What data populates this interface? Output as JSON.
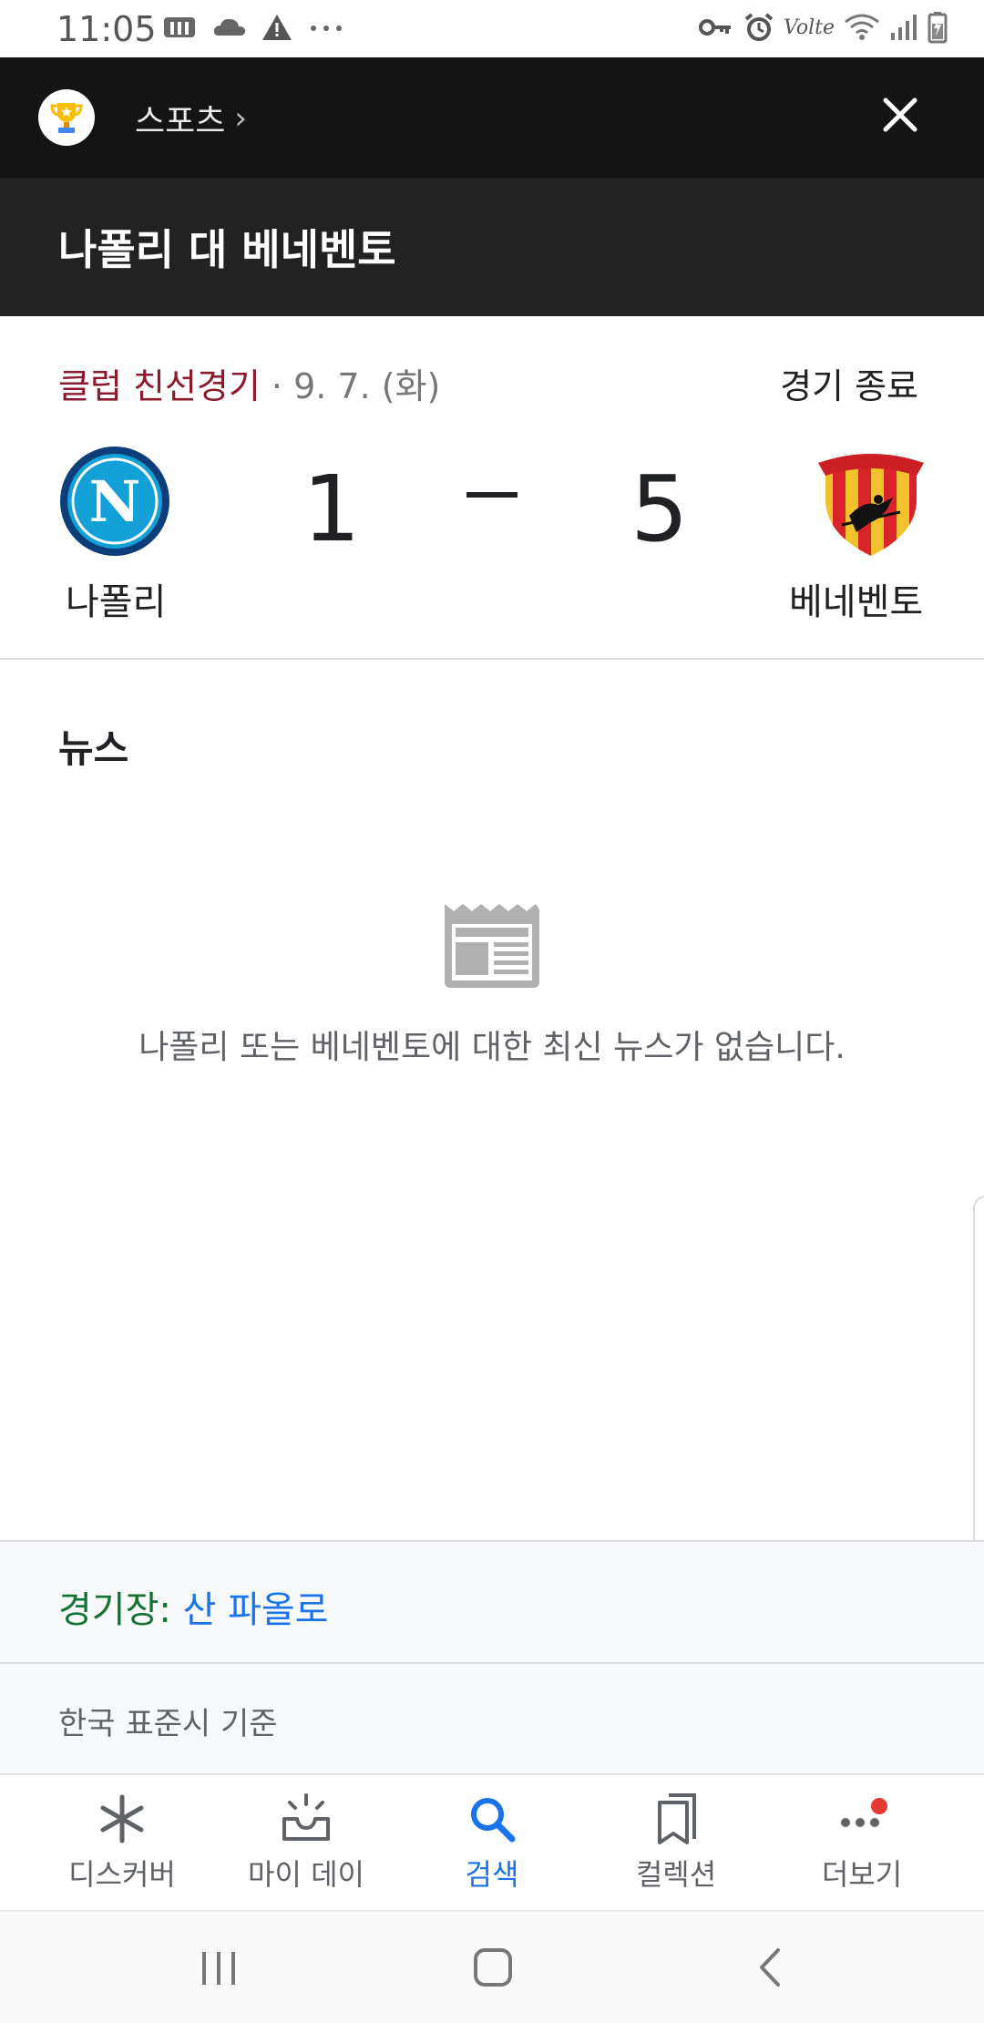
{
  "status_bar": {
    "time": "11:05",
    "left_icons": [
      "m-icon",
      "cloud-icon",
      "warning-icon",
      "more-dots-icon"
    ],
    "right_icons": [
      "vpn-key-icon",
      "alarm-icon",
      "volte-icon",
      "wifi-icon",
      "signal-icon",
      "battery-icon"
    ],
    "volte_text": "Volte"
  },
  "header": {
    "section_label": "스포츠",
    "chevron": "›",
    "match_title": "나폴리 대 베네벤토"
  },
  "match": {
    "league": "클럽 친선경기",
    "date": " · 9. 7. (화)",
    "status": "경기 종료",
    "home": {
      "name": "나폴리",
      "score": "1",
      "logo_letter": "N",
      "color": "#12a0d7"
    },
    "away": {
      "name": "베네벤토",
      "score": "5",
      "color": "#d8232a"
    }
  },
  "news": {
    "title": "뉴스",
    "empty_message": "나폴리 또는 베네벤토에 대한 최신 뉴스가 없습니다."
  },
  "venue": {
    "label": "경기장:",
    "value": " 산 파올로"
  },
  "timezone_note": "한국 표준시 기준",
  "bottom_nav": [
    {
      "label": "디스커버",
      "icon": "asterisk-icon",
      "active": false
    },
    {
      "label": "마이 데이",
      "icon": "sunrise-icon",
      "active": false
    },
    {
      "label": "검색",
      "icon": "search-icon",
      "active": true
    },
    {
      "label": "컬렉션",
      "icon": "collections-icon",
      "active": false
    },
    {
      "label": "더보기",
      "icon": "more-icon",
      "active": false
    }
  ],
  "colors": {
    "accent_blue": "#1a73e8",
    "league_red": "#8b1a2c",
    "venue_green": "#137333",
    "header_dark": "#222222",
    "notification_dot": "#e53935"
  }
}
